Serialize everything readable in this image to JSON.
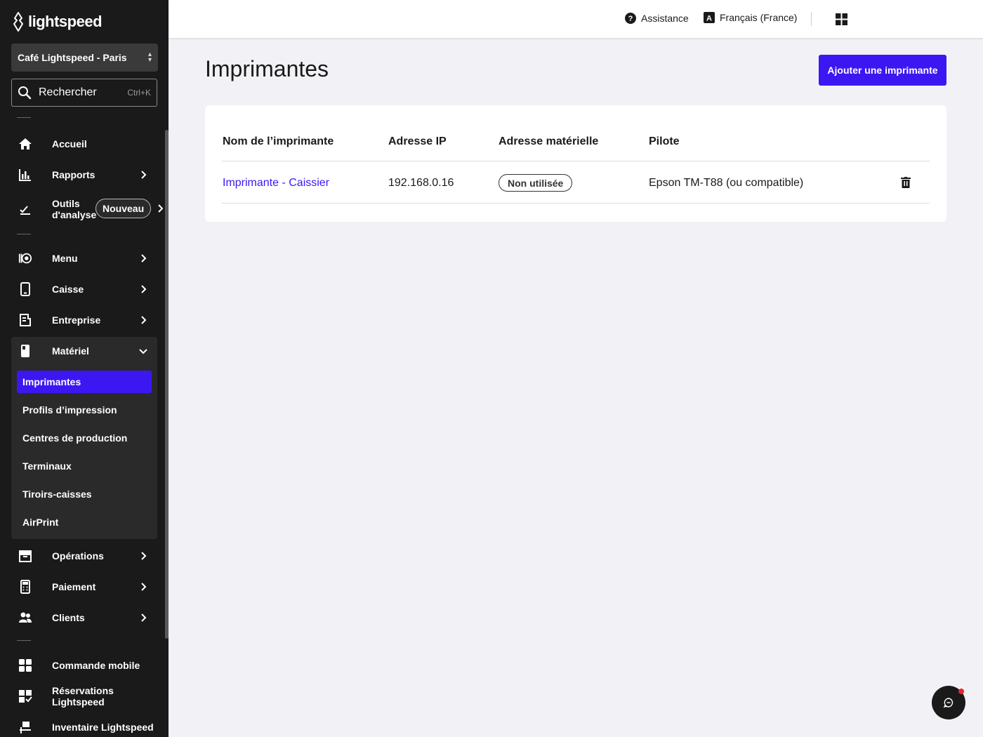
{
  "brand": {
    "name": "lightspeed"
  },
  "location": {
    "name": "Café Lightspeed - Paris"
  },
  "search": {
    "label": "Rechercher",
    "shortcut": "Ctrl+K"
  },
  "nav": {
    "accueil": "Accueil",
    "rapports": "Rapports",
    "outils_line1": "Outils",
    "outils_line2": "d'analyse",
    "outils_badge": "Nouveau",
    "menu": "Menu",
    "caisse": "Caisse",
    "entreprise": "Entreprise",
    "materiel": "Matériel",
    "operations": "Opérations",
    "paiement": "Paiement",
    "clients": "Clients",
    "commande_mobile": "Commande mobile",
    "reservations": "Réservations Lightspeed",
    "inventaire": "Inventaire Lightspeed"
  },
  "submenu": {
    "imprimantes": "Imprimantes",
    "profils": "Profils d’impression",
    "centres": "Centres de production",
    "terminaux": "Terminaux",
    "tiroirs": "Tiroirs-caisses",
    "airprint": "AirPrint"
  },
  "topbar": {
    "assistance": "Assistance",
    "language": "Français (France)"
  },
  "page": {
    "title": "Imprimantes",
    "add_button": "Ajouter une imprimante"
  },
  "table": {
    "headers": {
      "name": "Nom de l’imprimante",
      "ip": "Adresse IP",
      "hw": "Adresse matérielle",
      "driver": "Pilote"
    },
    "rows": [
      {
        "name": "Imprimante - Caissier",
        "ip": "192.168.0.16",
        "hw": "Non utilisée",
        "driver": "Epson TM-T88 (ou compatible)"
      }
    ]
  },
  "colors": {
    "accent": "#3d17f2",
    "sidebar": "#1a1a1a"
  }
}
